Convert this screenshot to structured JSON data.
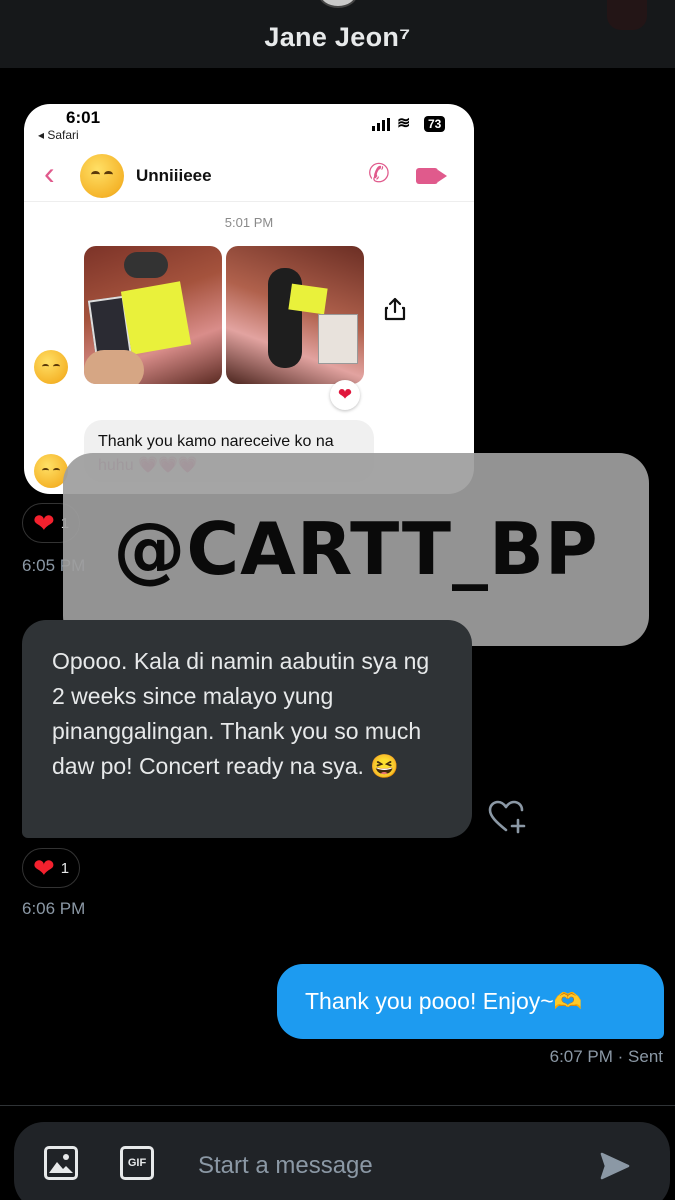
{
  "header": {
    "title": "Jane Jeon⁷"
  },
  "embedded_screenshot": {
    "status_time": "6:01",
    "back_label": "◂ Safari",
    "battery": "73",
    "contact_name": "Unniiieee",
    "timestamp": "5:01 PM",
    "message_text": "Thank you kamo nareceive ko na",
    "message_text_2": "huhu",
    "message_hearts": "💗💗💗",
    "photo_reaction": "❤"
  },
  "watermark": {
    "text": "@CARTT_BP"
  },
  "thread": {
    "reaction_1": {
      "heart": "❤",
      "count": "1"
    },
    "time_1": "6:05 PM",
    "incoming_message": "Opooo. Kala di namin aabutin sya ng 2 weeks since malayo yung pinanggalingan. Thank you so much daw po! Concert ready na sya. 😆",
    "reaction_2": {
      "heart": "❤",
      "count": "1"
    },
    "time_2": "6:06 PM",
    "outgoing_message": "Thank you pooo! Enjoy~🫶",
    "outgoing_meta": "6:07 PM · Sent"
  },
  "composer": {
    "gif_label": "GIF",
    "placeholder": "Start a message"
  },
  "colors": {
    "accent": "#1d9bf0",
    "incoming_bubble": "#2f3336",
    "heart": "#f4212e",
    "watermark_bg": "#9e9e9e",
    "messenger_pink": "#e05a8c"
  },
  "icons": [
    "image-icon",
    "gif-icon",
    "send-icon",
    "add-reaction-icon",
    "share-icon",
    "phone-icon",
    "video-icon",
    "back-chevron-icon"
  ]
}
